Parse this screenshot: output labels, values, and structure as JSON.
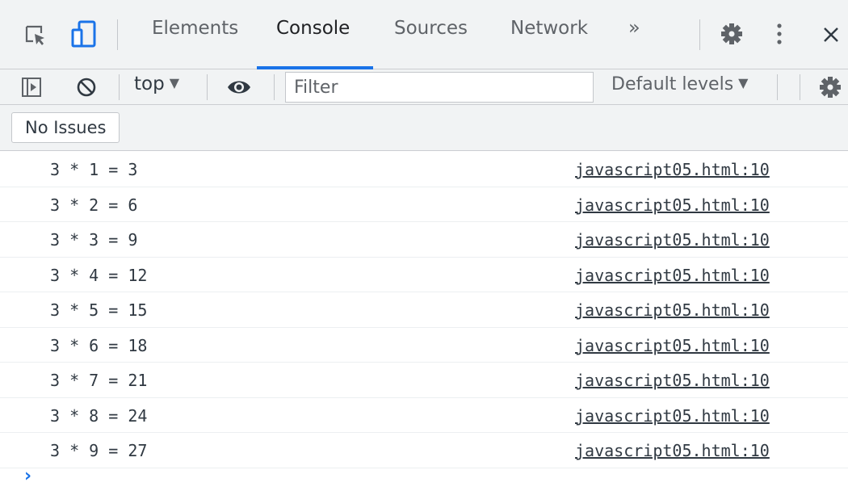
{
  "tabs": {
    "items": [
      {
        "label": "Elements",
        "active": false
      },
      {
        "label": "Console",
        "active": true
      },
      {
        "label": "Sources",
        "active": false
      },
      {
        "label": "Network",
        "active": false
      }
    ],
    "more_label": "»",
    "more_tabs_label": "»"
  },
  "toolbar": {
    "context": "top",
    "filter_placeholder": "Filter",
    "filter_value": "",
    "levels": "Default levels"
  },
  "issues": {
    "label": "No Issues"
  },
  "messages": [
    {
      "text": "3 * 1 = 3",
      "source": "javascript05.html:10"
    },
    {
      "text": "3 * 2 = 6",
      "source": "javascript05.html:10"
    },
    {
      "text": "3 * 3 = 9",
      "source": "javascript05.html:10"
    },
    {
      "text": "3 * 4 = 12",
      "source": "javascript05.html:10"
    },
    {
      "text": "3 * 5 = 15",
      "source": "javascript05.html:10"
    },
    {
      "text": "3 * 6 = 18",
      "source": "javascript05.html:10"
    },
    {
      "text": "3 * 7 = 21",
      "source": "javascript05.html:10"
    },
    {
      "text": "3 * 8 = 24",
      "source": "javascript05.html:10"
    },
    {
      "text": "3 * 9 = 27",
      "source": "javascript05.html:10"
    }
  ],
  "prompt_symbol": "›",
  "colors": {
    "accent": "#1a73e8",
    "toolbar_bg": "#f1f3f4",
    "text": "#303942"
  }
}
